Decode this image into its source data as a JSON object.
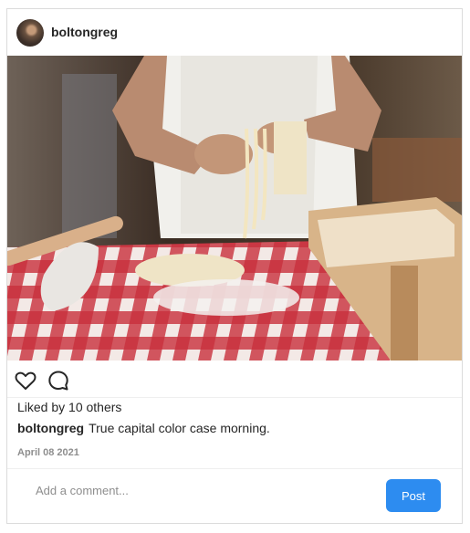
{
  "post": {
    "username": "boltongreg",
    "photo_icon": "pasta-making-photo",
    "likes_text": "Liked by 10 others",
    "caption_user": "boltongreg",
    "caption_text": "True capital color case morning.",
    "date": "April 08 2021"
  },
  "actions": {
    "like_icon": "heart-outline-icon",
    "comment_icon": "speech-bubble-icon"
  },
  "comment": {
    "placeholder": "Add a comment...",
    "post_label": "Post"
  },
  "colors": {
    "accent": "#2d8cf0",
    "border": "#dbdbdb",
    "muted": "#8e8e8e"
  }
}
